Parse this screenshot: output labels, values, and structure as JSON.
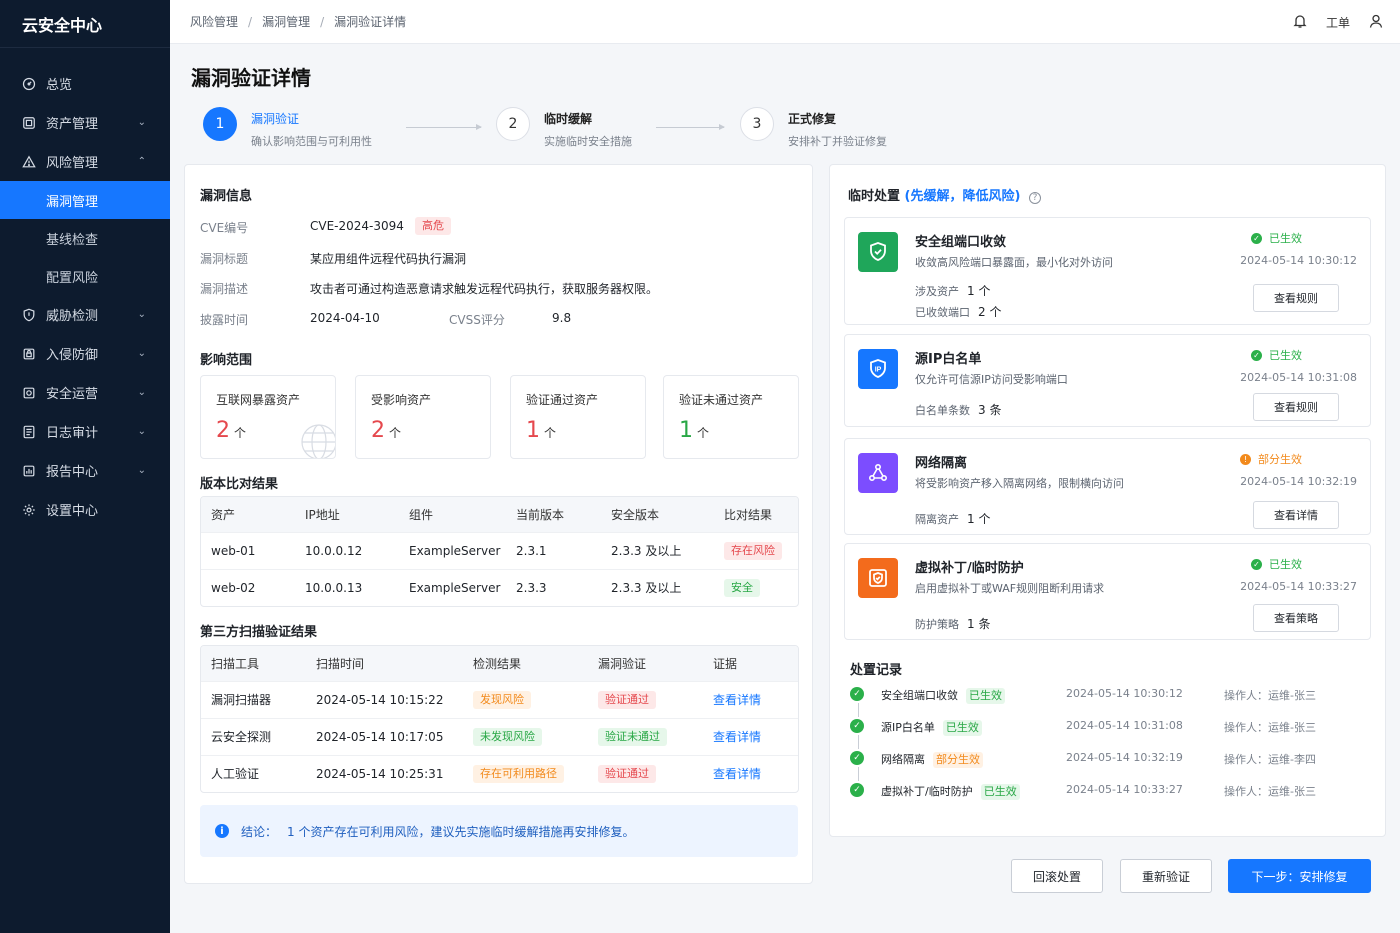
{
  "app": {
    "name": "云安全中心"
  },
  "sidebar": {
    "items": [
      {
        "label": "总览",
        "icon": "dashboard-icon"
      },
      {
        "label": "资产管理",
        "icon": "asset-icon"
      },
      {
        "label": "风险管理",
        "icon": "warning-icon",
        "expanded": true,
        "children": [
          {
            "label": "漏洞管理",
            "active": true
          },
          {
            "label": "基线检查"
          },
          {
            "label": "配置风险"
          }
        ]
      },
      {
        "label": "威胁检测",
        "icon": "shield-icon"
      },
      {
        "label": "入侵防御",
        "icon": "lock-icon"
      },
      {
        "label": "安全运营",
        "icon": "operation-icon"
      },
      {
        "label": "日志审计",
        "icon": "log-icon"
      },
      {
        "label": "报告中心",
        "icon": "report-icon"
      },
      {
        "label": "设置中心",
        "icon": "gear-icon"
      }
    ]
  },
  "topbar": {
    "breadcrumb": [
      "风险管理",
      "漏洞管理",
      "漏洞验证详情"
    ],
    "ticket_label": "工单"
  },
  "page": {
    "title": "漏洞验证详情"
  },
  "steps": [
    {
      "num": "1",
      "title": "漏洞验证",
      "desc": "确认影响范围与可利用性",
      "status": "active"
    },
    {
      "num": "2",
      "title": "临时缓解",
      "desc": "实施临时安全措施",
      "status": "todo"
    },
    {
      "num": "3",
      "title": "正式修复",
      "desc": "安排补丁并验证修复",
      "status": "todo"
    }
  ],
  "vuln": {
    "section_title": "漏洞信息",
    "cve_label": "CVE编号",
    "cve": "CVE-2024-3094",
    "severity": "高危",
    "title_label": "漏洞标题",
    "title": "某应用组件远程代码执行漏洞",
    "desc_label": "漏洞描述",
    "desc": "攻击者可通过构造恶意请求触发远程代码执行，获取服务器权限。",
    "date_label": "披露时间",
    "date": "2024-04-10",
    "cvss_label": "CVSS评分",
    "cvss": "9.8"
  },
  "impact": {
    "section_title": "影响范围",
    "unit": "个",
    "stats": [
      {
        "label": "互联网暴露资产",
        "value": "2",
        "color": "#e5484d"
      },
      {
        "label": "受影响资产",
        "value": "2",
        "color": "#e5484d"
      },
      {
        "label": "验证通过资产",
        "value": "1",
        "color": "#e5484d"
      },
      {
        "label": "验证未通过资产",
        "value": "1",
        "color": "#28a745"
      }
    ]
  },
  "version_compare": {
    "section_title": "版本比对结果",
    "headers": [
      "资产",
      "IP地址",
      "组件",
      "当前版本",
      "安全版本",
      "比对结果"
    ],
    "rows": [
      {
        "asset": "web-01",
        "ip": "10.0.0.12",
        "component": "ExampleServer",
        "current": "2.3.1",
        "safe": "2.3.3 及以上",
        "result": "存在风险",
        "result_type": "red"
      },
      {
        "asset": "web-02",
        "ip": "10.0.0.13",
        "component": "ExampleServer",
        "current": "2.3.3",
        "safe": "2.3.3 及以上",
        "result": "安全",
        "result_type": "green"
      }
    ]
  },
  "third_party": {
    "section_title": "第三方扫描验证结果",
    "headers": [
      "扫描工具",
      "扫描时间",
      "检测结果",
      "漏洞验证",
      "证据"
    ],
    "rows": [
      {
        "tool": "漏洞扫描器",
        "time": "2024-05-14 10:15:22",
        "detect": "发现风险",
        "detect_type": "orange",
        "verify": "验证通过",
        "verify_type": "red",
        "evidence": "查看详情"
      },
      {
        "tool": "云安全探测",
        "time": "2024-05-14 10:17:05",
        "detect": "未发现风险",
        "detect_type": "green",
        "verify": "验证未通过",
        "verify_type": "green",
        "evidence": "查看详情"
      },
      {
        "tool": "人工验证",
        "time": "2024-05-14 10:25:31",
        "detect": "存在可利用路径",
        "detect_type": "orange",
        "verify": "验证通过",
        "verify_type": "red",
        "evidence": "查看详情"
      }
    ]
  },
  "conclusion": {
    "prefix": "结论：",
    "text": "1 个资产存在可利用风险，建议先实施临时缓解措施再安排修复。"
  },
  "temp": {
    "title": "临时处置",
    "subtitle": "(先缓解，降低风险)",
    "measures": [
      {
        "title": "安全组端口收敛",
        "desc": "收敛高风险端口暴露面，最小化对外访问",
        "status": "已生效",
        "status_color": "#2bb04a",
        "time": "2024-05-14 10:30:12",
        "metas": [
          {
            "label": "涉及资产",
            "value": "1 个"
          },
          {
            "label": "已收敛端口",
            "value": "2 个"
          }
        ],
        "button": "查看规则",
        "icon": "shield-check-icon",
        "icon_bg": "#1fa65a"
      },
      {
        "title": "源IP白名单",
        "desc": "仅允许可信源IP访问受影响端口",
        "status": "已生效",
        "status_color": "#2bb04a",
        "time": "2024-05-14 10:31:08",
        "metas": [
          {
            "label": "白名单条数",
            "value": "3 条"
          }
        ],
        "button": "查看规则",
        "icon": "ip-shield-icon",
        "icon_bg": "#1677ff"
      },
      {
        "title": "网络隔离",
        "desc": "将受影响资产移入隔离网络，限制横向访问",
        "status": "部分生效",
        "status_color": "#f28a1c",
        "time": "2024-05-14 10:32:19",
        "metas": [
          {
            "label": "隔离资产",
            "value": "1 个"
          }
        ],
        "button": "查看详情",
        "icon": "network-icon",
        "icon_bg": "#7c4dff"
      },
      {
        "title": "虚拟补丁/临时防护",
        "desc": "启用虚拟补丁或WAF规则阻断利用请求",
        "status": "已生效",
        "status_color": "#2bb04a",
        "time": "2024-05-14 10:33:27",
        "metas": [
          {
            "label": "防护策略",
            "value": "1 条"
          }
        ],
        "button": "查看策略",
        "icon": "patch-shield-icon",
        "icon_bg": "#f36b1c"
      }
    ]
  },
  "records": {
    "title": "处置记录",
    "items": [
      {
        "name": "安全组端口收敛",
        "status": "已生效",
        "status_type": "green",
        "time": "2024-05-14 10:30:12",
        "operator": "操作人：运维-张三"
      },
      {
        "name": "源IP白名单",
        "status": "已生效",
        "status_type": "green",
        "time": "2024-05-14 10:31:08",
        "operator": "操作人：运维-张三"
      },
      {
        "name": "网络隔离",
        "status": "部分生效",
        "status_type": "orange",
        "time": "2024-05-14 10:32:19",
        "operator": "操作人：运维-李四"
      },
      {
        "name": "虚拟补丁/临时防护",
        "status": "已生效",
        "status_type": "green",
        "time": "2024-05-14 10:33:27",
        "operator": "操作人：运维-张三"
      }
    ]
  },
  "actions": {
    "rollback": "回滚处置",
    "reverify": "重新验证",
    "next": "下一步：安排修复"
  }
}
